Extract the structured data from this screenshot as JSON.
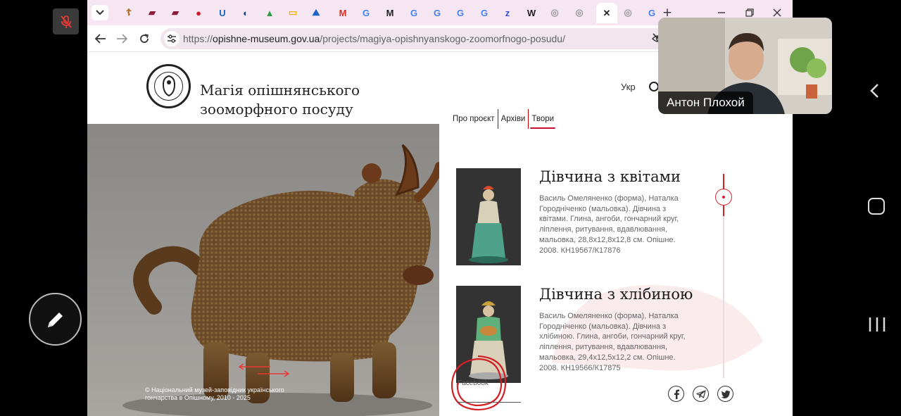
{
  "browser": {
    "url": {
      "scheme": "https://",
      "host": "opishne-museum.gov.ua",
      "path": "/projects/magiya-opishnyanskogo-zoomorfnogo-posudu/"
    },
    "tabs": [
      {
        "icon": "cross-icon",
        "glyph": "☦",
        "color": "#b06a2a"
      },
      {
        "icon": "book-icon",
        "glyph": "▰",
        "color": "#8a1d3c"
      },
      {
        "icon": "book-icon",
        "glyph": "▰",
        "color": "#8a1d3c"
      },
      {
        "icon": "japan-flag-icon",
        "glyph": "●",
        "color": "#d0142a"
      },
      {
        "icon": "u-icon",
        "glyph": "U",
        "color": "#1565c0"
      },
      {
        "icon": "contrast-icon",
        "glyph": "◐",
        "color": "#1a3e7a"
      },
      {
        "icon": "google-drive-icon",
        "glyph": "▲",
        "color": "#2d9a3e"
      },
      {
        "icon": "slides-icon",
        "glyph": "▭",
        "color": "#f2b400"
      },
      {
        "icon": "ukraine-icon",
        "glyph": "⛰",
        "color": "#1f64c8"
      },
      {
        "icon": "gmail-icon",
        "glyph": "M",
        "color": "#d93025"
      },
      {
        "icon": "google-icon",
        "glyph": "G",
        "color": "#4285f4"
      },
      {
        "icon": "m-icon",
        "glyph": "M",
        "color": "#222"
      },
      {
        "icon": "google-icon",
        "glyph": "G",
        "color": "#4285f4"
      },
      {
        "icon": "google-icon",
        "glyph": "G",
        "color": "#4285f4"
      },
      {
        "icon": "google-icon",
        "glyph": "G",
        "color": "#4285f4"
      },
      {
        "icon": "google-icon",
        "glyph": "G",
        "color": "#4285f4"
      },
      {
        "icon": "zoom-icon",
        "glyph": "z",
        "color": "#2a4fd8"
      },
      {
        "icon": "wikipedia-icon",
        "glyph": "W",
        "color": "#222"
      },
      {
        "icon": "museum-icon",
        "glyph": "◎",
        "color": "#999"
      },
      {
        "icon": "museum-icon",
        "glyph": "◎",
        "color": "#999"
      },
      {
        "icon": "close-icon",
        "glyph": "✕",
        "color": "#222"
      },
      {
        "icon": "museum-icon",
        "glyph": "◎",
        "color": "#999"
      },
      {
        "icon": "google-icon",
        "glyph": "G",
        "color": "#4285f4"
      }
    ],
    "new_tab": "+"
  },
  "site": {
    "title_line1": "Магія опішнянського",
    "title_line2": "зооморфного посуду",
    "lang": "Укр",
    "nav": [
      {
        "label": "Про проєкт",
        "active": false
      },
      {
        "label": "Архіви",
        "active": false
      },
      {
        "label": "Твори",
        "active": true
      }
    ]
  },
  "hero": {
    "copyright_line1": "© Національний музей-заповідник українського",
    "copyright_line2": "гончарства в Опішному, 2010 - 2025"
  },
  "items": [
    {
      "title": "Дівчина з квітами",
      "description": "Василь Омеляненко (форма), Наталка Городніченко (мальовка). Дівчина з квітами. Глина, ангоби, гончарний круг, ліплення, ритування, вдавлювання, мальовка, 28,8х12,8х12,8 см. Опішне. 2008. КН19567/К17876"
    },
    {
      "title": "Дівчина з хлібиною",
      "description": "Василь Омеляненко (форма), Наталка Городніченко (мальовка). Дівчина з хлібиною. Глина, ангоби, гончарний круг, ліплення, ритування, вдавлювання, мальовка, 29,4х12,5х12,2 см. Опішне. 2008. КН19566/К17875"
    }
  ],
  "footer": {
    "facebook_label": "Facebook",
    "social": [
      "facebook-icon",
      "telegram-icon",
      "twitter-icon"
    ]
  },
  "video": {
    "participant_name": "Антон Плохой"
  },
  "colors": {
    "accent_red": "#d32027",
    "tabstrip_bg": "#f6e6f1",
    "urlbar_bg": "#f1e5ee"
  }
}
